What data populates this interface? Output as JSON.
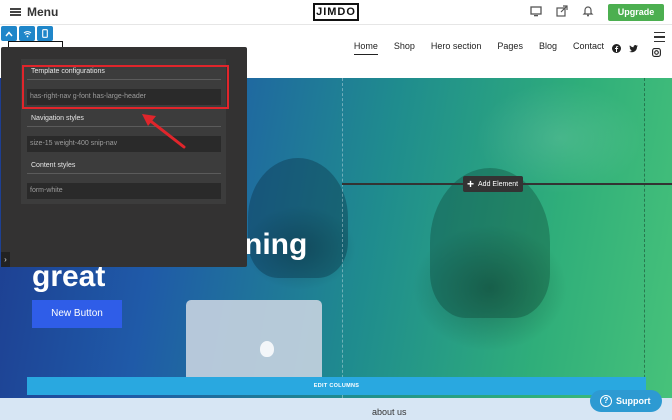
{
  "topbar": {
    "menu_label": "Menu",
    "logo_text": "JIMDO",
    "upgrade_label": "Upgrade",
    "icons": [
      "desktop-preview-icon",
      "share-icon",
      "notification-bell-icon"
    ]
  },
  "site_nav": {
    "items": [
      "Home",
      "Shop",
      "Hero section",
      "Pages",
      "Blog",
      "Contact"
    ],
    "active": "Home",
    "social_icons": [
      "facebook-icon",
      "twitter-icon",
      "instagram-icon"
    ]
  },
  "panel": {
    "sections": [
      {
        "label": "Template configurations",
        "value": "has-right-nav g-font has-large-header"
      },
      {
        "label": "Navigation styles",
        "value": "size-15 weight-400 snip-nav"
      },
      {
        "label": "Content styles",
        "value": "form-white"
      }
    ]
  },
  "hero": {
    "title_line1": "ning",
    "title_line2": "great",
    "button_label": "New Button",
    "add_element_label": "Add Element",
    "edit_columns_label": "EDIT COLUMNS"
  },
  "footer": {
    "about_label": "about us",
    "support_label": "Support"
  },
  "colors": {
    "upgrade": "#4caf50",
    "button": "#2f5de8",
    "edit_columns": "#29a8e0",
    "support": "#2d9ad2",
    "highlight": "#e0252b"
  }
}
